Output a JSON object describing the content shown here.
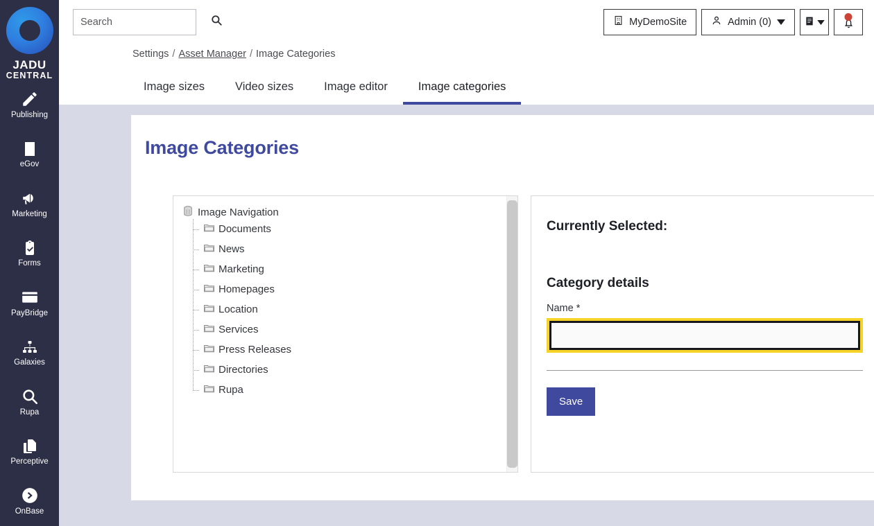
{
  "brand": {
    "logo_line1": "JADU",
    "logo_line2": "CENTRAL",
    "accent_color": "#3f4a9e",
    "sidebar_color": "#2c2f45",
    "focus_ring_color": "#f5d328"
  },
  "sidebar": {
    "items": [
      {
        "label": "Publishing",
        "icon": "pencil-icon"
      },
      {
        "label": "eGov",
        "icon": "building-icon"
      },
      {
        "label": "Marketing",
        "icon": "megaphone-icon"
      },
      {
        "label": "Forms",
        "icon": "clipboard-check-icon"
      },
      {
        "label": "PayBridge",
        "icon": "credit-card-icon"
      },
      {
        "label": "Galaxies",
        "icon": "sitemap-icon"
      },
      {
        "label": "Rupa",
        "icon": "search-icon"
      },
      {
        "label": "Perceptive",
        "icon": "documents-icon"
      },
      {
        "label": "OnBase",
        "icon": "arrow-circle-icon"
      }
    ]
  },
  "topbar": {
    "search_placeholder": "Search",
    "search_value": "",
    "site_button": "MyDemoSite",
    "admin_button": "Admin (0)",
    "notification_dot_color": "#cc4436"
  },
  "breadcrumb": {
    "root": "Settings",
    "link": "Asset Manager",
    "current": "Image Categories",
    "separator": "/"
  },
  "tabs": [
    {
      "label": "Image sizes",
      "active": false
    },
    {
      "label": "Video sizes",
      "active": false
    },
    {
      "label": "Image editor",
      "active": false
    },
    {
      "label": "Image categories",
      "active": true
    }
  ],
  "page": {
    "title": "Image Categories"
  },
  "tree": {
    "root_label": "Image Navigation",
    "root_icon": "database-icon",
    "nodes": [
      {
        "label": "Documents",
        "icon": "folder-icon"
      },
      {
        "label": "News",
        "icon": "folder-icon"
      },
      {
        "label": "Marketing",
        "icon": "folder-icon"
      },
      {
        "label": "Homepages",
        "icon": "folder-icon"
      },
      {
        "label": "Location",
        "icon": "folder-icon"
      },
      {
        "label": "Services",
        "icon": "folder-icon"
      },
      {
        "label": "Press Releases",
        "icon": "folder-icon"
      },
      {
        "label": "Directories",
        "icon": "folder-icon"
      },
      {
        "label": "Rupa",
        "icon": "folder-icon"
      }
    ]
  },
  "details": {
    "currently_selected_label": "Currently Selected:",
    "currently_selected_value": "",
    "section_title": "Category details",
    "name_label": "Name *",
    "name_value": "",
    "save_label": "Save"
  }
}
